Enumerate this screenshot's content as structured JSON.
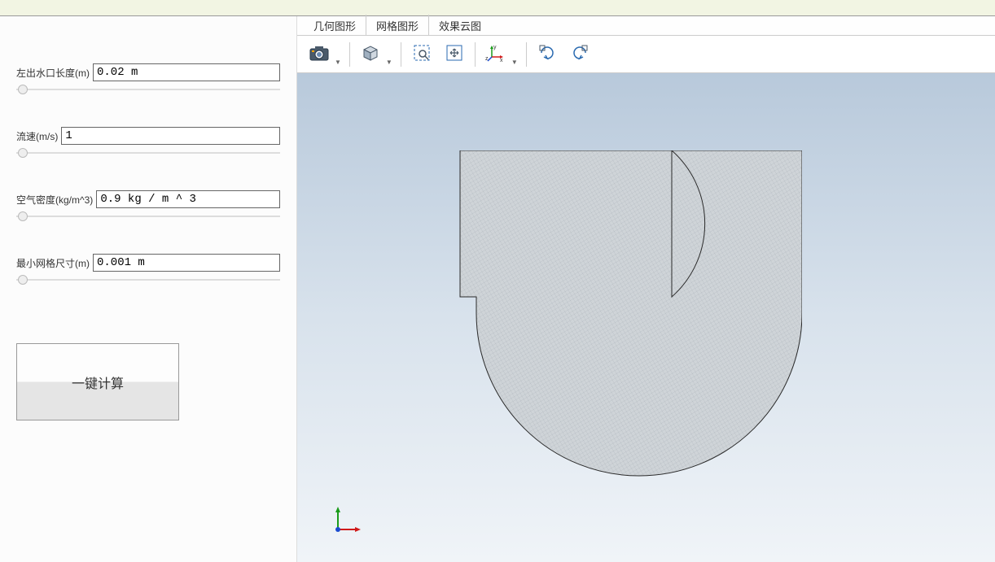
{
  "sidebar": {
    "params": [
      {
        "label": "左出水口长度(m)",
        "value": "0.02 m"
      },
      {
        "label": "流速(m/s)",
        "value": "1"
      },
      {
        "label": "空气密度(kg/m^3)",
        "value": "0.9 kg / m ^ 3"
      },
      {
        "label": "最小网格尺寸(m)",
        "value": "0.001 m"
      }
    ],
    "calc_button_label": "一键计算"
  },
  "tabs": [
    {
      "label": "几何图形"
    },
    {
      "label": "网格图形"
    },
    {
      "label": "效果云图"
    }
  ],
  "toolbar_icons": {
    "camera": "camera-icon",
    "view_cube": "view-cube-icon",
    "zoom_region": "zoom-region-icon",
    "pan": "pan-icon",
    "axes": "axes-triad-icon",
    "rotate_cw": "rotate-cw-icon",
    "rotate_ccw": "rotate-ccw-icon"
  }
}
